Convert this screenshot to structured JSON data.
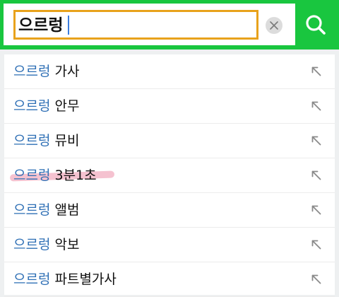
{
  "search": {
    "query": "으르렁",
    "clear_icon": "clear-x-icon",
    "search_icon": "magnifier-icon"
  },
  "colors": {
    "brand_green": "#19c63f",
    "input_border": "#e8a21c",
    "keyword": "#2e6fb5",
    "highlight": "#e97896"
  },
  "suggestions": [
    {
      "keyword": "으르렁",
      "suffix": " 가사"
    },
    {
      "keyword": "으르렁",
      "suffix": " 안무"
    },
    {
      "keyword": "으르렁",
      "suffix": " 뮤비"
    },
    {
      "keyword": "으르렁",
      "suffix": " 3분1초"
    },
    {
      "keyword": "으르렁",
      "suffix": " 앨범"
    },
    {
      "keyword": "으르렁",
      "suffix": " 악보"
    },
    {
      "keyword": "으르렁",
      "suffix": " 파트별가사"
    }
  ],
  "suggestion_icon": "arrow-up-left-icon"
}
